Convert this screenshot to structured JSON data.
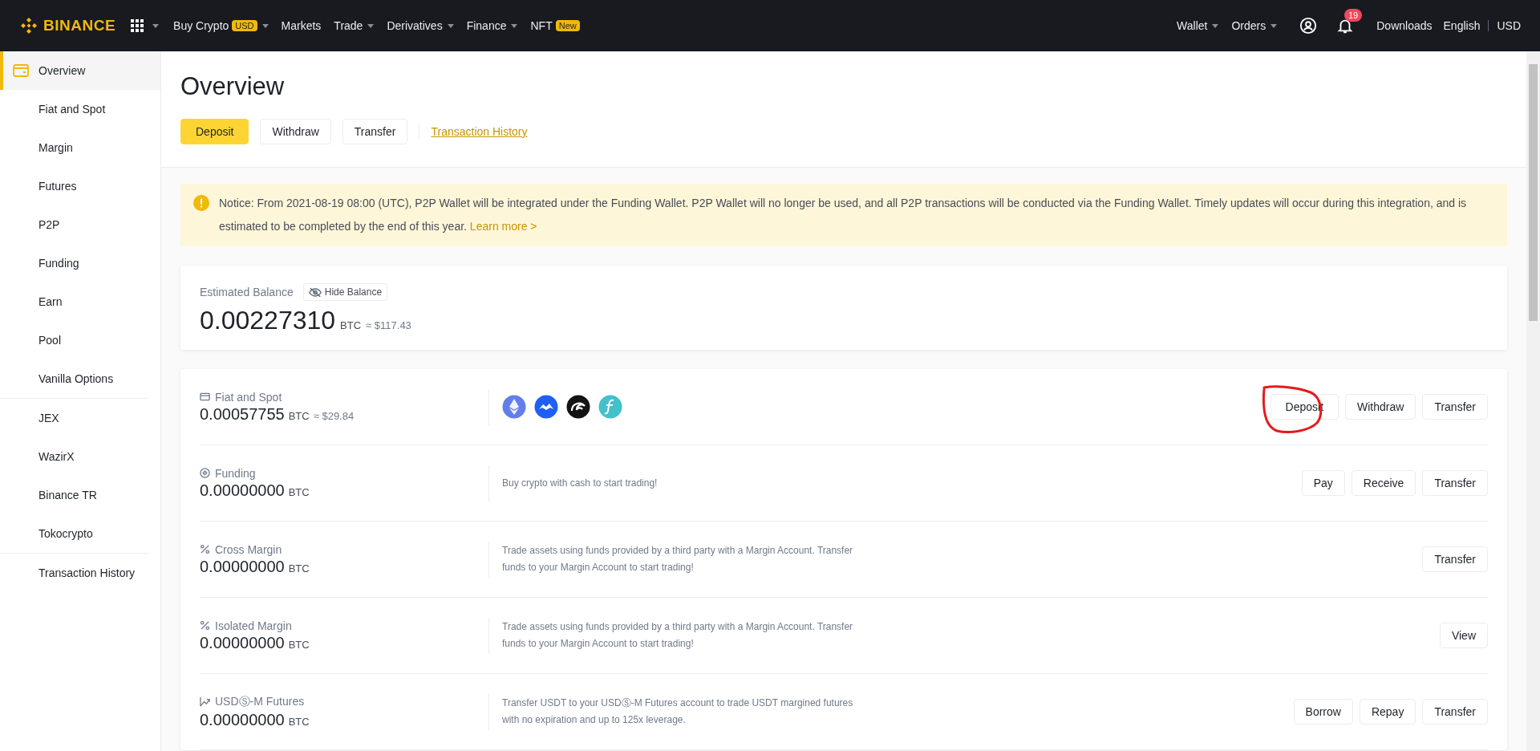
{
  "nav": {
    "logo": "BINANCE",
    "items": [
      {
        "label": "Buy Crypto",
        "badge": "USD",
        "dropdown": true
      },
      {
        "label": "Markets",
        "dropdown": false
      },
      {
        "label": "Trade",
        "dropdown": true
      },
      {
        "label": "Derivatives",
        "dropdown": true
      },
      {
        "label": "Finance",
        "dropdown": true
      },
      {
        "label": "NFT",
        "badge": "New",
        "dropdown": false
      }
    ],
    "right_items": [
      {
        "label": "Wallet",
        "dropdown": true
      },
      {
        "label": "Orders",
        "dropdown": true
      }
    ],
    "notifications": "19",
    "downloads": "Downloads",
    "language": "English",
    "currency": "USD"
  },
  "sidebar": {
    "groups": [
      [
        {
          "label": "Overview",
          "selected": true
        },
        {
          "label": "Fiat and Spot",
          "selected": false
        },
        {
          "label": "Margin",
          "selected": false
        },
        {
          "label": "Futures",
          "selected": false
        },
        {
          "label": "P2P",
          "selected": false
        },
        {
          "label": "Funding",
          "selected": false
        },
        {
          "label": "Earn",
          "selected": false
        },
        {
          "label": "Pool",
          "selected": false
        },
        {
          "label": "Vanilla Options",
          "selected": false
        }
      ],
      [
        {
          "label": "JEX",
          "selected": false
        },
        {
          "label": "WazirX",
          "selected": false
        },
        {
          "label": "Binance TR",
          "selected": false
        },
        {
          "label": "Tokocrypto",
          "selected": false
        }
      ],
      [
        {
          "label": "Transaction History",
          "selected": false
        }
      ]
    ]
  },
  "title": "Overview",
  "actions": [
    {
      "label": "Deposit",
      "kind": "primary"
    },
    {
      "label": "Withdraw",
      "kind": "default"
    },
    {
      "label": "Transfer",
      "kind": "default"
    },
    {
      "label": "Transaction History",
      "kind": "link"
    }
  ],
  "notice": {
    "text": "Notice: From 2021-08-19 08:00 (UTC), P2P Wallet will be integrated under the Funding Wallet. P2P Wallet will no longer be used, and all P2P transactions will be conducted via the Funding Wallet. Timely updates will occur during this integration, and is estimated to be completed by the end of this year.",
    "link": "Learn more >"
  },
  "balance": {
    "label": "Estimated Balance",
    "hide_button": "Hide Balance",
    "amount": "0.00227310",
    "unit": "BTC",
    "approx": "≈ $117.43"
  },
  "wallets": [
    {
      "kind": "card",
      "name": "Fiat and Spot",
      "amount": "0.00057755",
      "unit": "BTC",
      "approx": "≈ $29.84",
      "coins": [
        {
          "kind": "diamond",
          "color": "#627eea"
        },
        {
          "kind": "mountain",
          "color": "#1f5ff5"
        },
        {
          "kind": "wave",
          "color": "#141414"
        },
        {
          "kind": "stroke",
          "color": "#42c1ca"
        }
      ],
      "buttons": [
        {
          "label": "Deposit",
          "circled": true
        },
        {
          "label": "Withdraw",
          "circled": false
        },
        {
          "label": "Transfer",
          "circled": false
        }
      ]
    },
    {
      "kind": "target",
      "name": "Funding",
      "amount": "0.00000000",
      "unit": "BTC",
      "description": "Buy crypto with cash to start trading!",
      "buttons": [
        {
          "label": "Pay",
          "circled": false
        },
        {
          "label": "Receive",
          "circled": false
        },
        {
          "label": "Transfer",
          "circled": false
        }
      ]
    },
    {
      "kind": "percent",
      "name": "Cross Margin",
      "amount": "0.00000000",
      "unit": "BTC",
      "description": "Trade assets using funds provided by a third party with a Margin Account. Transfer funds to your Margin Account to start trading!",
      "buttons": [
        {
          "label": "Transfer",
          "circled": false
        }
      ]
    },
    {
      "kind": "percent",
      "name": "Isolated Margin",
      "amount": "0.00000000",
      "unit": "BTC",
      "description": "Trade assets using funds provided by a third party with a Margin Account. Transfer funds to your Margin Account to start trading!",
      "buttons": [
        {
          "label": "View",
          "circled": false
        }
      ]
    },
    {
      "kind": "trend",
      "name": "USDⓈ-M Futures",
      "amount": "0.00000000",
      "unit": "BTC",
      "description": "Transfer USDT to your USDⓈ-M Futures account to trade USDT margined futures with no expiration and up to 125x leverage.",
      "buttons": [
        {
          "label": "Borrow",
          "circled": false
        },
        {
          "label": "Repay",
          "circled": false
        },
        {
          "label": "Transfer",
          "circled": false
        }
      ]
    }
  ]
}
